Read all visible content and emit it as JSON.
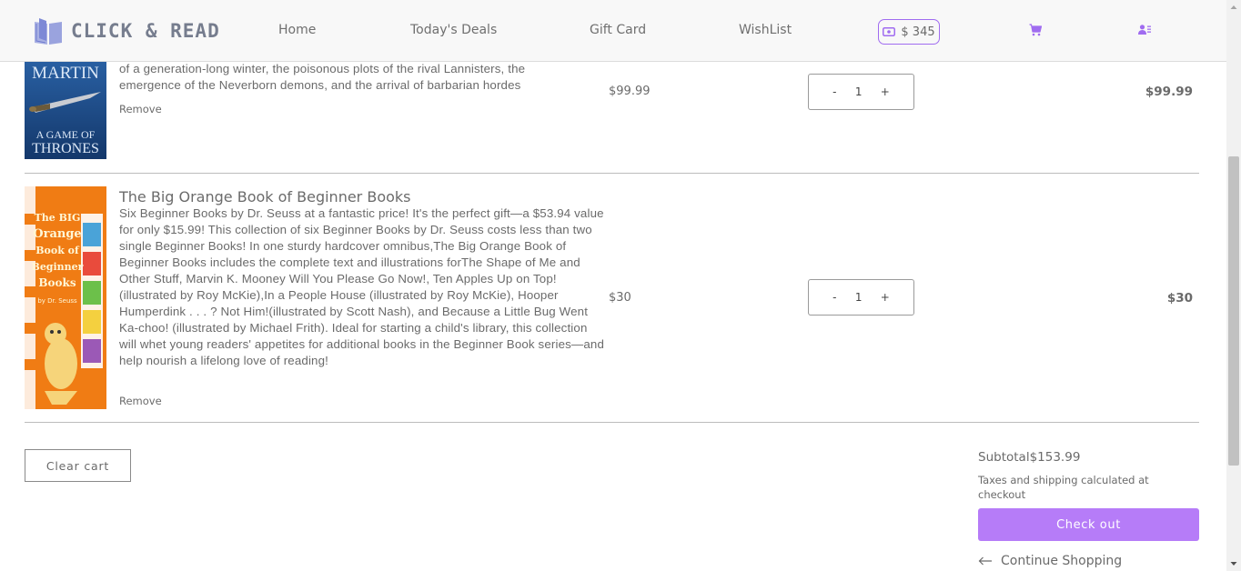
{
  "header": {
    "logo_text": "CLICK & READ",
    "nav": [
      "Home",
      "Today's Deals",
      "Gift Card",
      "WishList"
    ],
    "wallet_amount": "$ 345",
    "accent_color": "#a06cf0"
  },
  "cart": {
    "items": [
      {
        "title": "A Game of Thrones",
        "cover_text_top": "MARTIN",
        "cover_text_bottom_1": "A GAME OF",
        "cover_text_bottom_2": "THRONES",
        "desc_line1": "of a generation-long winter, the poisonous plots of the rival Lannisters, the",
        "desc_line2": "emergence of the Neverborn demons, and the arrival of barbarian hordes",
        "remove": "Remove",
        "price": "$99.99",
        "qty": "1",
        "total": "$99.99"
      },
      {
        "title": "The Big Orange Book of Beginner Books",
        "description": "Six Beginner Books by Dr. Seuss at a fantastic price! It's the perfect gift—a $53.94 value for only $15.99! This collection of six Beginner Books by Dr. Seuss costs less than two single Beginner Books! In one sturdy hardcover omnibus,The Big Orange Book of Beginner Books includes the complete text and illustrations forThe Shape of Me and Other Stuff, Marvin K. Mooney Will You Please Go Now!, Ten Apples Up on Top! (illustrated by Roy McKie),In a People House (illustrated by Roy McKie), Hooper Humperdink . . . ? Not Him!(illustrated by Scott Nash), and Because a Little Bug Went Ka-choo! (illustrated by Michael Frith). Ideal for starting a child's library, this collection will whet young readers' appetites for additional books in the Beginner Book series—and help nourish a lifelong love of reading!",
        "cover_text": "The BIG Orange Book of Beginner Books by Dr. Seuss",
        "remove": "Remove",
        "price": "$30",
        "qty": "1",
        "total": "$30"
      }
    ],
    "qty_minus": "-",
    "qty_plus": "+"
  },
  "footer": {
    "clear_cart": "Clear cart",
    "subtotal_label": "Subtotal",
    "subtotal_value": "$153.99",
    "tax_note": "Taxes and shipping calculated at checkout",
    "checkout": "Check out",
    "continue": "Continue Shopping",
    "checkout_color": "#b67cf8"
  }
}
